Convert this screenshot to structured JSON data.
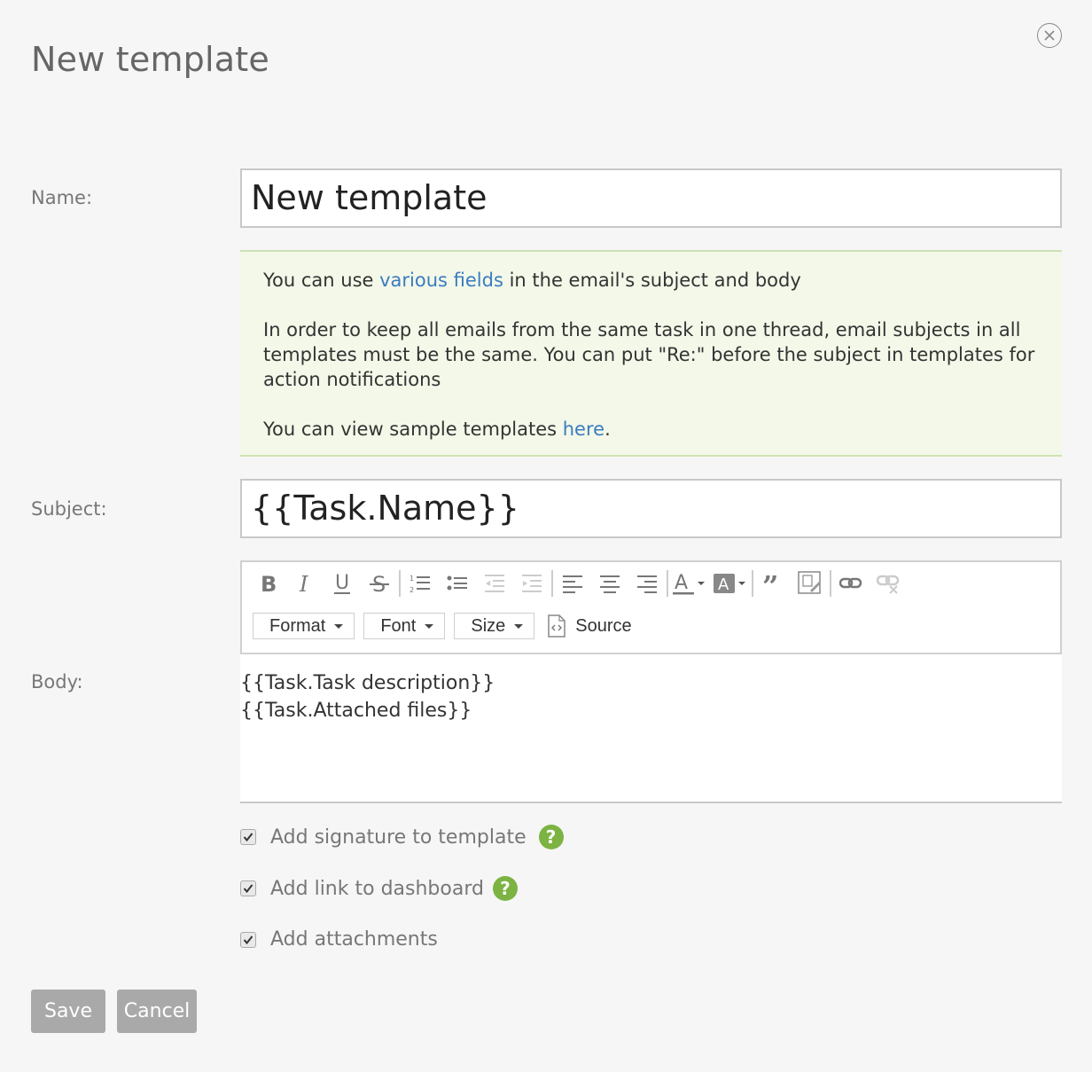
{
  "dialog": {
    "title": "New template",
    "close_icon": "close-circle-icon"
  },
  "form": {
    "name_label": "Name:",
    "name_value": "New template",
    "subject_label": "Subject:",
    "subject_value": "{{Task.Name}}",
    "body_label": "Body:"
  },
  "info": {
    "line1_before": "You can use ",
    "line1_link": "various fields",
    "line1_after": " in the email's subject and body",
    "paragraph2": "In order to keep all emails from the same task in one thread, email subjects in all templates must be the same. You can put \"Re:\" before the subject in templates for action notifications",
    "line3_before": "You can view sample templates ",
    "line3_link": "here",
    "line3_after": ".",
    "link_color": "#3a7cbf",
    "background": "#f3f8e9"
  },
  "toolbar": {
    "icons": [
      "bold-icon",
      "italic-icon",
      "underline-icon",
      "strikethrough-icon",
      "numbered-list-icon",
      "bulleted-list-icon",
      "decrease-indent-icon",
      "increase-indent-icon",
      "align-left-icon",
      "align-center-icon",
      "align-right-icon",
      "text-color-icon",
      "background-color-icon",
      "blockquote-icon",
      "template-icon",
      "link-icon",
      "unlink-icon"
    ],
    "format_label": "Format",
    "font_label": "Font",
    "size_label": "Size",
    "source_label": "Source"
  },
  "body": {
    "line1": "{{Task.Task description}}",
    "line2": "{{Task.Attached files}}"
  },
  "options": [
    {
      "label": "Add signature to template",
      "checked": true,
      "help": true
    },
    {
      "label": "Add link to dashboard",
      "checked": true,
      "help": true
    },
    {
      "label": "Add attachments",
      "checked": true,
      "help": false
    }
  ],
  "help_symbol": "?",
  "help_color": "#7cb342",
  "buttons": {
    "save": "Save",
    "cancel": "Cancel",
    "color": "#a9a9a9"
  }
}
